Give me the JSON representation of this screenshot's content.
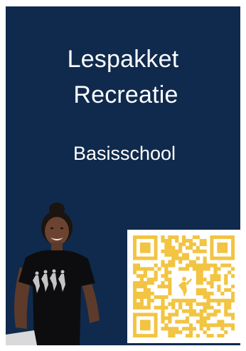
{
  "poster": {
    "title_line1": "Lespakket",
    "title_line2": "Recreatie",
    "subtitle": "Basisschool"
  },
  "colors": {
    "background": "#0f2a4c",
    "text": "#ffffff",
    "qr": "#f2c441"
  },
  "images": {
    "photo": "dancer-girl-photo",
    "code": "qr-code-icon"
  }
}
